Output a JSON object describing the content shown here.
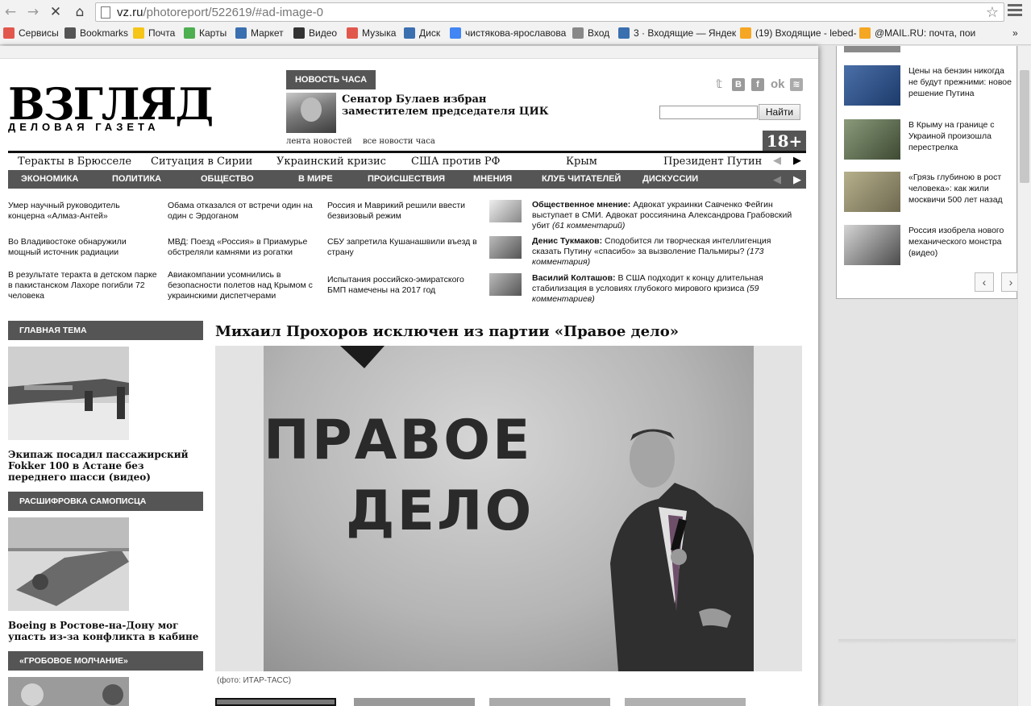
{
  "browser": {
    "url_host": "vz.ru",
    "url_path": "/photoreport/522619/#ad-image-0",
    "bookmarks": [
      "Сервисы",
      "Bookmarks",
      "Почта",
      "Карты",
      "Маркет",
      "Видео",
      "Музыка",
      "Диск",
      "чистякова-ярославова",
      "Вход",
      "3 · Входящие — Яндек",
      "(19) Входящие - lebed-",
      "@MAIL.RU: почта, пои"
    ],
    "bookmark_colors": [
      "#e2574c",
      "#555555",
      "#f5c518",
      "#4caf50",
      "#3a6fb0",
      "#333333",
      "#e2574c",
      "#3a6fb0",
      "#4285f4",
      "#888888",
      "#3a6fb0",
      "#f5a623",
      "#f5a623"
    ]
  },
  "header": {
    "logo": "ВЗГЛЯД",
    "logo_sub": "ДЕЛОВАЯ ГАЗЕТА",
    "news_hour_label": "НОВОСТЬ ЧАСА",
    "news_hour_headline": "Сенатор Булаев избран заместителем председателя ЦИК",
    "news_feed_link": "лента новостей",
    "all_news_link": "все новости часа",
    "search_placeholder": "",
    "search_button": "Найти",
    "age_badge": "18+",
    "social": [
      "twitter",
      "vk",
      "facebook",
      "odnoklassniki",
      "rss"
    ]
  },
  "topics": [
    "Теракты в Брюсселе",
    "Ситуация в Сирии",
    "Украинский кризис",
    "США против РФ",
    "Крым",
    "Президент Путин"
  ],
  "sections": [
    "ЭКОНОМИКА",
    "ПОЛИТИКА",
    "ОБЩЕСТВО",
    "В МИРЕ",
    "ПРОИСШЕСТВИЯ",
    "МНЕНИЯ",
    "КЛУБ ЧИТАТЕЛЕЙ",
    "ДИСКУССИИ"
  ],
  "news": [
    "Умер научный руководитель концерна «Алмаз-Антей»",
    "Обама отказался от встречи один на один с Эрдоганом",
    "Россия и Маврикий решили ввести безвизовый режим",
    "Во Владивостоке обнаружили мощный источник радиации",
    "МВД: Поезд «Россия» в Приамурье обстреляли камнями из рогатки",
    "СБУ запретила Кушанашвили въезд в страну",
    "В результате теракта в детском парке в пакистанском Лахоре погибли 72 человека",
    "Авиакомпании усомнились в безопасности полетов над Крымом с украинскими диспетчерами",
    "Испытания российско-эмиратского БМП намечены на 2017 год"
  ],
  "opinions": [
    {
      "author": "Общественное мнение:",
      "text": " Адвокат украинки Савченко Фейгин выступает в СМИ. Адвокат россиянина Александрова Грабовский убит",
      "comments": "(61 комментарий)"
    },
    {
      "author": "Денис Тукмаков:",
      "text": " Сподобится ли творческая интеллигенция сказать Путину «спасибо» за вызволение Пальмиры?",
      "comments": "(173 комментария)"
    },
    {
      "author": "Василий Колташов:",
      "text": " В США подходит к концу длительная стабилизация в условиях глубокого мирового кризиса",
      "comments": "(59 комментариев)"
    }
  ],
  "left_blocks": [
    {
      "head": "ГЛАВНАЯ ТЕМА",
      "caption": "Экипаж посадил пассажирский Fokker 100 в Астане без переднего шасси (видео)"
    },
    {
      "head": "РАСШИФРОВКА САМОПИСЦА",
      "caption": "Boeing в Ростове-на-Дону мог упасть из-за конфликта в кабине"
    },
    {
      "head": "«ГРОБОВОЕ МОЛЧАНИЕ»",
      "caption": ""
    }
  ],
  "article": {
    "title": "Михаил Прохоров исключен из партии «Правое дело»",
    "photo_sign_line1": "ПРАВОЕ",
    "photo_sign_line2": "ДЕЛО",
    "photo_credit": "(фото: ИТАР-ТАСС)"
  },
  "widget": {
    "items": [
      "Цены на бензин никогда не будут прежними: новое решение Путина",
      "В Крыму на границе с Украиной произошла перестрелка",
      "«Грязь глубиною в рост человека»: как жили москвичи 500 лет назад",
      "Россия изобрела нового механического монстра (видео)"
    ],
    "prev": "‹",
    "next": "›"
  }
}
